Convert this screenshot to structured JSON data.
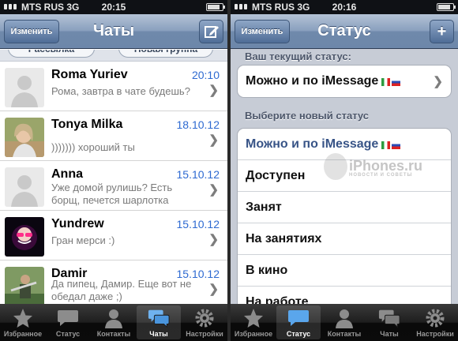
{
  "left": {
    "status_bar": {
      "carrier": "MTS RUS  3G",
      "time": "20:15"
    },
    "nav": {
      "edit_label": "Изменить",
      "title": "Чаты"
    },
    "peek_buttons": [
      "Рассылка",
      "Новая группа"
    ],
    "chats": [
      {
        "name": "Roma Yuriev",
        "date": "20:10",
        "message": "Рома, завтра в чате будешь?"
      },
      {
        "name": "Tonya Milka",
        "date": "18.10.12",
        "message": "))))))) хороший ты"
      },
      {
        "name": "Anna",
        "date": "15.10.12",
        "message": "Уже домой рулишь? Есть борщ, печется шарлотка"
      },
      {
        "name": "Yundrew",
        "date": "15.10.12",
        "message": "Гран мерси :)"
      },
      {
        "name": "Damir",
        "date": "15.10.12",
        "message": "Да пипец, Дамир. Еще вот не обедал даже ;)"
      }
    ],
    "tabs": [
      "Избранное",
      "Статус",
      "Контакты",
      "Чаты",
      "Настройки"
    ],
    "active_tab": "Чаты"
  },
  "right": {
    "status_bar": {
      "carrier": "MTS RUS  3G",
      "time": "20:16"
    },
    "nav": {
      "edit_label": "Изменить",
      "title": "Статус",
      "add_label": "+"
    },
    "current_header": "Ваш текущий статус:",
    "current_status": "Можно и по iMessage",
    "new_header": "Выберите новый статус",
    "options": [
      "Можно и по iMessage",
      "Доступен",
      "Занят",
      "На занятиях",
      "В кино",
      "На работе"
    ],
    "watermark": "iPhones.ru",
    "watermark_sub": "НОВОСТИ И СОВЕТЫ",
    "tabs": [
      "Избранное",
      "Статус",
      "Контакты",
      "Чаты",
      "Настройки"
    ],
    "active_tab": "Статус"
  },
  "colors": {
    "accent": "#2e6ad1",
    "nav_blue": "#6f89ab",
    "selected_status": "#385487"
  }
}
